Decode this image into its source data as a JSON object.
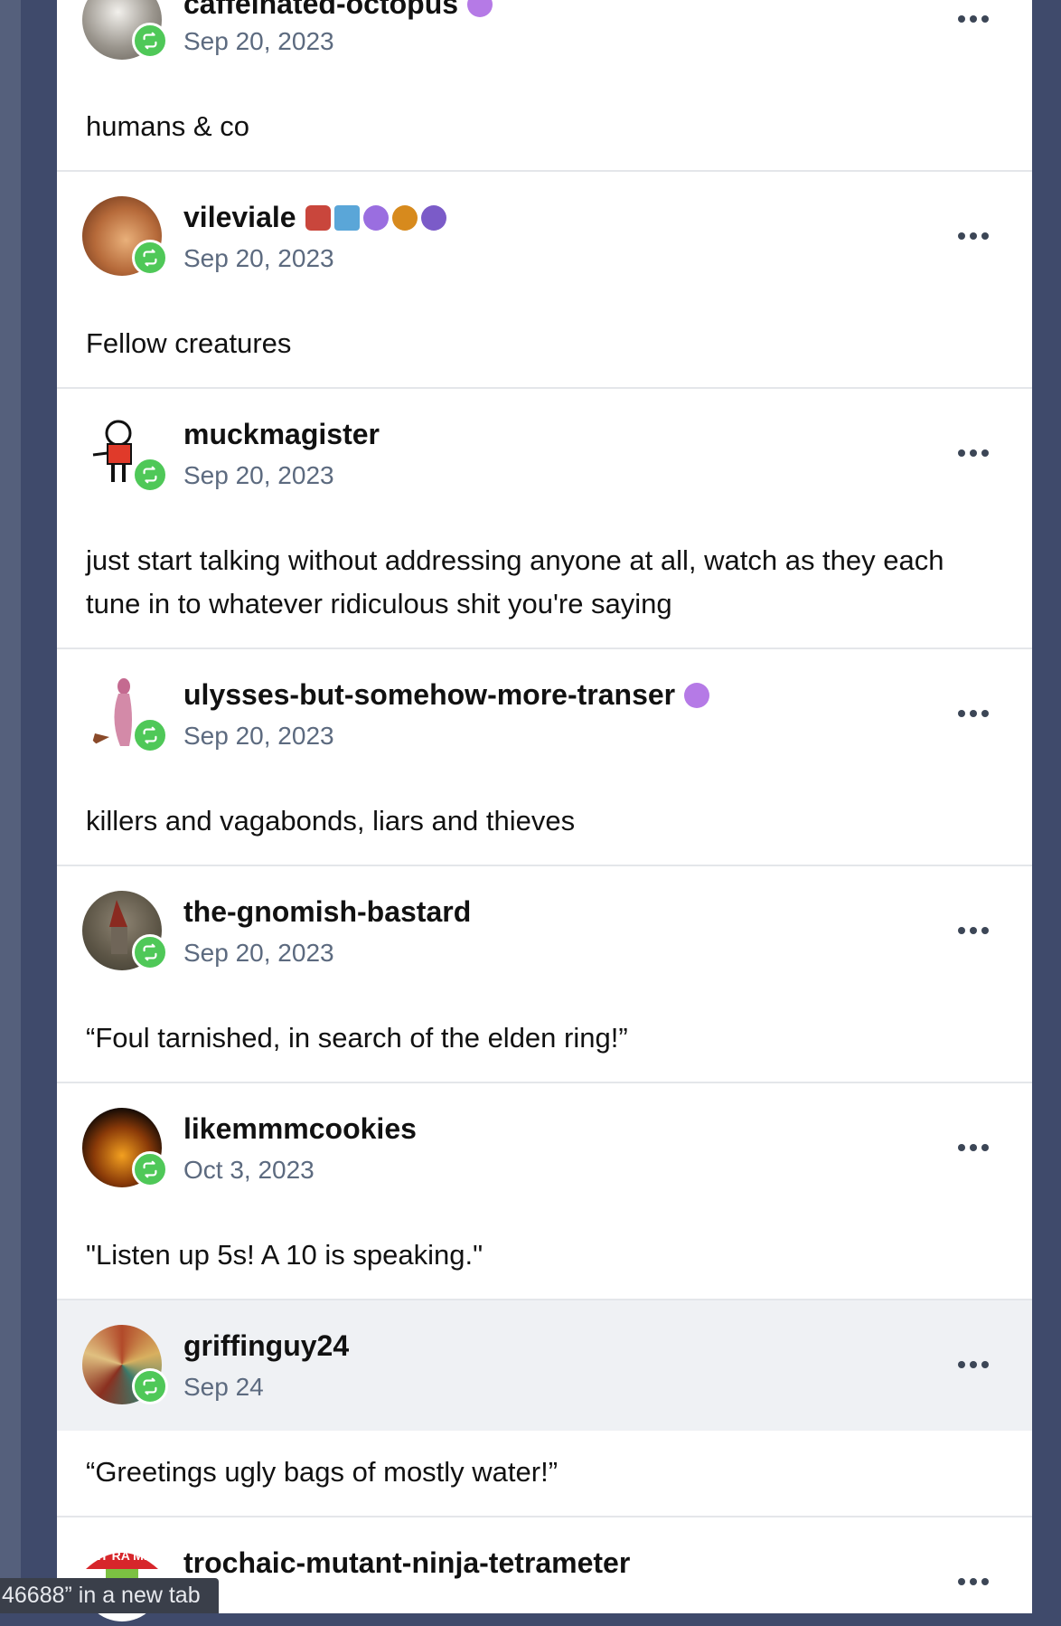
{
  "notes": [
    {
      "username": "caffeinated-octopus",
      "date": "Sep 20, 2023",
      "text": "humans & co"
    },
    {
      "username": "vileviale",
      "date": "Sep 20, 2023",
      "text": "Fellow creatures"
    },
    {
      "username": "muckmagister",
      "date": "Sep 20, 2023",
      "text": "just start talking without addressing anyone at all, watch as they each tune in to whatever ridiculous shit you're saying"
    },
    {
      "username": "ulysses-but-somehow-more-transer",
      "date": "Sep 20, 2023",
      "text": "killers and vagabonds, liars and thieves"
    },
    {
      "username": "the-gnomish-bastard",
      "date": "Sep 20, 2023",
      "text": "“Foul tarnished, in search of the elden ring!”"
    },
    {
      "username": "likemmmcookies",
      "date": "Oct 3, 2023",
      "text": "\"Listen up 5s! A 10 is speaking.\""
    },
    {
      "username": "griffinguy24",
      "date": "Sep 24",
      "text": "“Greetings ugly bags of mostly water!”"
    },
    {
      "username": "trochaic-mutant-ninja-tetrameter",
      "date": "",
      "text": ""
    }
  ],
  "avatar_logo_text": "ET RA ME",
  "badge_icon": "reblog-icon",
  "more_icon": "ellipsis-icon",
  "colors": {
    "reblog_badge": "#4fc858",
    "date_text": "#5c6a7f",
    "highlight_row": "#eff1f4",
    "page_bg": "#3f4a6b"
  },
  "status_bar": {
    "text": "46688” in a new tab"
  }
}
